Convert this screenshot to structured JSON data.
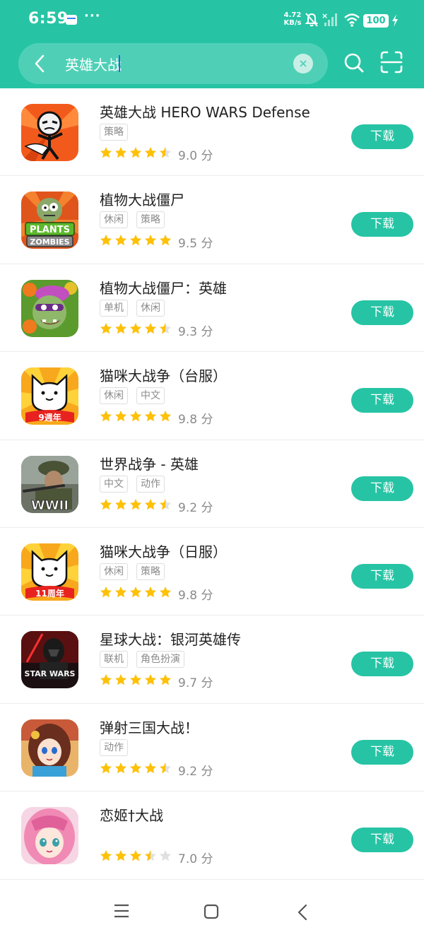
{
  "status": {
    "time": "6:59",
    "more": "···",
    "net_speed_value": "4.72",
    "net_speed_unit": "KB/s",
    "battery": "100"
  },
  "search": {
    "query": "英雄大战",
    "placeholder": "",
    "back_icon": "chevron-left-icon",
    "clear_icon": "clear-circle-icon",
    "search_icon": "search-icon",
    "scan_icon": "scan-icon"
  },
  "colors": {
    "brand": "#26c4a4",
    "star": "#ffc107",
    "star_empty": "#e0e0e0"
  },
  "apps": [
    {
      "name": "英雄大战 HERO WARS Defense",
      "tags": [
        "策略"
      ],
      "rating": 4.5,
      "score": "9.0 分",
      "button": "下载",
      "icon": "hero-wars-stickman-icon"
    },
    {
      "name": "植物大战僵尸",
      "tags": [
        "休闲",
        "策略"
      ],
      "rating": 5,
      "score": "9.5 分",
      "button": "下载",
      "icon": "plants-vs-zombies-icon"
    },
    {
      "name": "植物大战僵尸：英雄",
      "tags": [
        "单机",
        "休闲"
      ],
      "rating": 4.5,
      "score": "9.3 分",
      "button": "下载",
      "icon": "pvz-heroes-icon"
    },
    {
      "name": "猫咪大战争（台服）",
      "tags": [
        "休闲",
        "中文"
      ],
      "rating": 5,
      "score": "9.8 分",
      "button": "下载",
      "icon": "battle-cats-9-icon",
      "icon_text": "9週年"
    },
    {
      "name": "世界战争 - 英雄",
      "tags": [
        "中文",
        "动作"
      ],
      "rating": 4.5,
      "score": "9.2 分",
      "button": "下载",
      "icon": "world-war-soldier-icon",
      "icon_text": "WWII"
    },
    {
      "name": "猫咪大战争（日服）",
      "tags": [
        "休闲",
        "策略"
      ],
      "rating": 5,
      "score": "9.8 分",
      "button": "下载",
      "icon": "battle-cats-11-icon",
      "icon_text": "11周年"
    },
    {
      "name": "星球大战：银河英雄传",
      "tags": [
        "联机",
        "角色扮演"
      ],
      "rating": 5,
      "score": "9.7 分",
      "button": "下载",
      "icon": "star-wars-icon",
      "icon_text": "STAR WARS"
    },
    {
      "name": "弹射三国大战！",
      "tags": [
        "动作"
      ],
      "rating": 4.5,
      "score": "9.2 分",
      "button": "下载",
      "icon": "anime-girl-icon"
    },
    {
      "name": "恋姬†大战",
      "tags": [],
      "rating": 3.5,
      "score": "7.0 分",
      "button": "下载",
      "icon": "pink-hair-girl-icon"
    }
  ],
  "nav": {
    "menu_icon": "menu-icon",
    "home_icon": "home-square-icon",
    "back_icon": "back-triangle-icon"
  }
}
